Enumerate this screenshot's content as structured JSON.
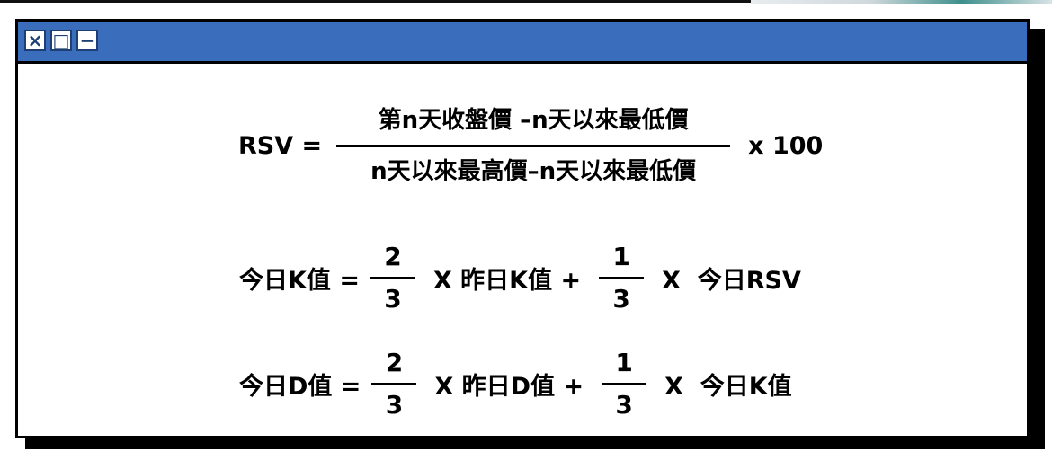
{
  "window": {
    "close_glyph": "×",
    "maximize_glyph": "□",
    "minimize_glyph": "−",
    "titlebar_color": "#3a6ebd",
    "border_color": "#000000",
    "shadow_color": "#000000"
  },
  "formulas": {
    "rsv": {
      "lhs": "RSV =",
      "numerator": "第n天收盤價 –n天以來最低價",
      "denominator": "n天以來最高價–n天以來最低價",
      "rhs": "x 100"
    },
    "k": {
      "lhs": "今日K值 =",
      "frac1_num": "2",
      "frac1_den": "3",
      "mid": "X 昨日K值 +",
      "frac2_num": "1",
      "frac2_den": "3",
      "rhs": "X  今日RSV"
    },
    "d": {
      "lhs": "今日D值 =",
      "frac1_num": "2",
      "frac1_den": "3",
      "mid": "X 昨日D值 +",
      "frac2_num": "1",
      "frac2_den": "3",
      "rhs": "X  今日K值"
    }
  }
}
